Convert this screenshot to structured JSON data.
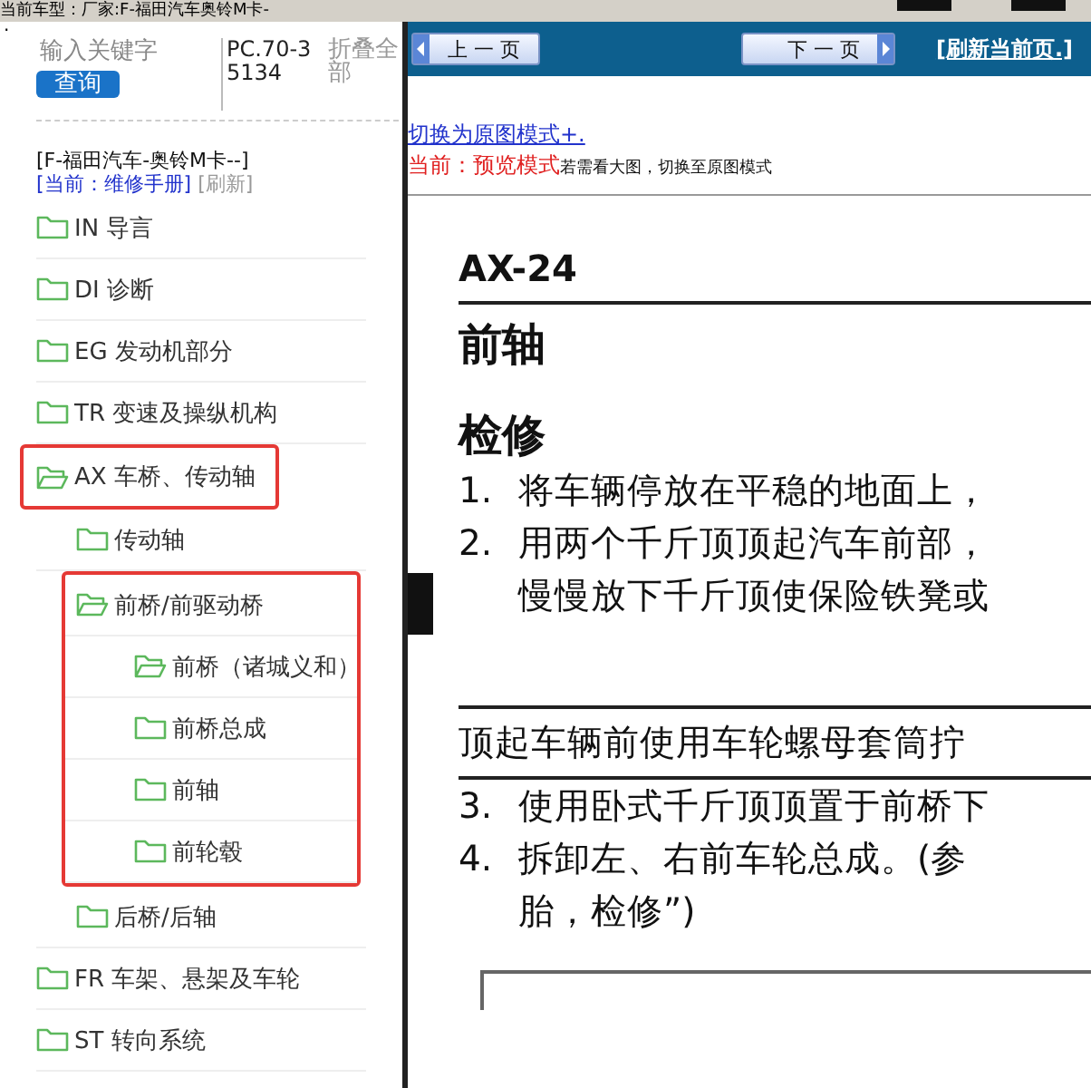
{
  "top_bar": {
    "model_label": "当前车型：厂家:F-福田汽车奥铃M卡-"
  },
  "sidebar": {
    "marker": ".",
    "search": {
      "placeholder": "输入关键字"
    },
    "search_button": "查询",
    "code": "PC.70-35134",
    "collapse_all": "折叠全部",
    "vehicle": "[F-福田汽车-奥铃M卡--]",
    "current_mode": "[当前：维修手册]",
    "refresh": "[刷新]",
    "tree": [
      {
        "label": "IN 导言",
        "expanded": false
      },
      {
        "label": "DI 诊断",
        "expanded": false
      },
      {
        "label": "EG 发动机部分",
        "expanded": false
      },
      {
        "label": "TR 变速及操纵机构",
        "expanded": false
      },
      {
        "label": "AX 车桥、传动轴",
        "expanded": true,
        "highlighted": true,
        "children": [
          {
            "label": "传动轴",
            "expanded": false
          },
          {
            "label": "前桥/前驱动桥",
            "expanded": true,
            "group_highlighted": true,
            "children": [
              {
                "label": "前桥（诸城义和）",
                "expanded": true
              },
              {
                "label": "前桥总成",
                "expanded": false
              },
              {
                "label": "前轴",
                "expanded": false
              },
              {
                "label": "前轮毂",
                "expanded": false
              }
            ]
          },
          {
            "label": "后桥/后轴",
            "expanded": false
          }
        ]
      },
      {
        "label": "FR 车架、悬架及车轮",
        "expanded": false
      },
      {
        "label": "ST 转向系统",
        "expanded": false
      }
    ]
  },
  "toolbar": {
    "prev_button": "上 一 页",
    "next_button": "下 一 页",
    "refresh_link": "[刷新当前页.]"
  },
  "view_mode": {
    "switch_link": "切换为原图模式+.",
    "current": "当前：预览模式",
    "hint": "若需看大图，切换至原图模式"
  },
  "document": {
    "page_code": "AX-24",
    "title": "前轴",
    "section": "检修",
    "lines": [
      {
        "kind": "step",
        "number": "1.",
        "text": "将车辆停放在平稳的地面上，"
      },
      {
        "kind": "step",
        "number": "2.",
        "text": "用两个千斤顶顶起汽车前部，"
      },
      {
        "kind": "cont",
        "text": "慢慢放下千斤顶使保险铁凳或"
      },
      {
        "kind": "note",
        "text": "顶起车辆前使用车轮螺母套筒拧"
      },
      {
        "kind": "step",
        "number": "3.",
        "text": "使用卧式千斤顶顶置于前桥下"
      },
      {
        "kind": "step",
        "number": "4.",
        "text": "拆卸左、右前车轮总成。(参"
      },
      {
        "kind": "cont",
        "text": "胎，检修”)"
      }
    ]
  }
}
